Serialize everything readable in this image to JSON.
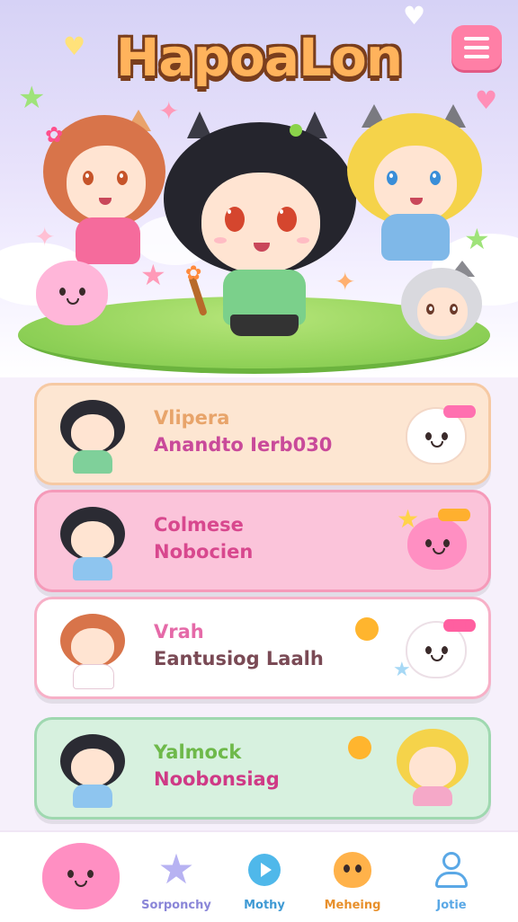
{
  "app": {
    "title": "HapoaLon"
  },
  "header": {
    "menu_icon": "hamburger-menu-icon",
    "menu_color": "#ff7fa6"
  },
  "cards": [
    {
      "title": "Vlipera",
      "subtitle": "Anandto Ierb030",
      "bg": "#fde6d2"
    },
    {
      "title": "Colmese",
      "subtitle": "Nobocien",
      "bg": "#fbc4da"
    },
    {
      "title": "Vrah",
      "subtitle": "Eantusiog Laalh",
      "bg": "#ffffff"
    },
    {
      "title": "Yalmock",
      "subtitle": "Noobonsiag",
      "bg": "#d7f1df"
    }
  ],
  "nav": [
    {
      "label": "",
      "icon": "pink-cat-icon"
    },
    {
      "label": "Sorponchy",
      "icon": "star-icon"
    },
    {
      "label": "Mothy",
      "icon": "play-icon"
    },
    {
      "label": "Meheing",
      "icon": "puppy-icon"
    },
    {
      "label": "Jotie",
      "icon": "user-icon"
    }
  ]
}
